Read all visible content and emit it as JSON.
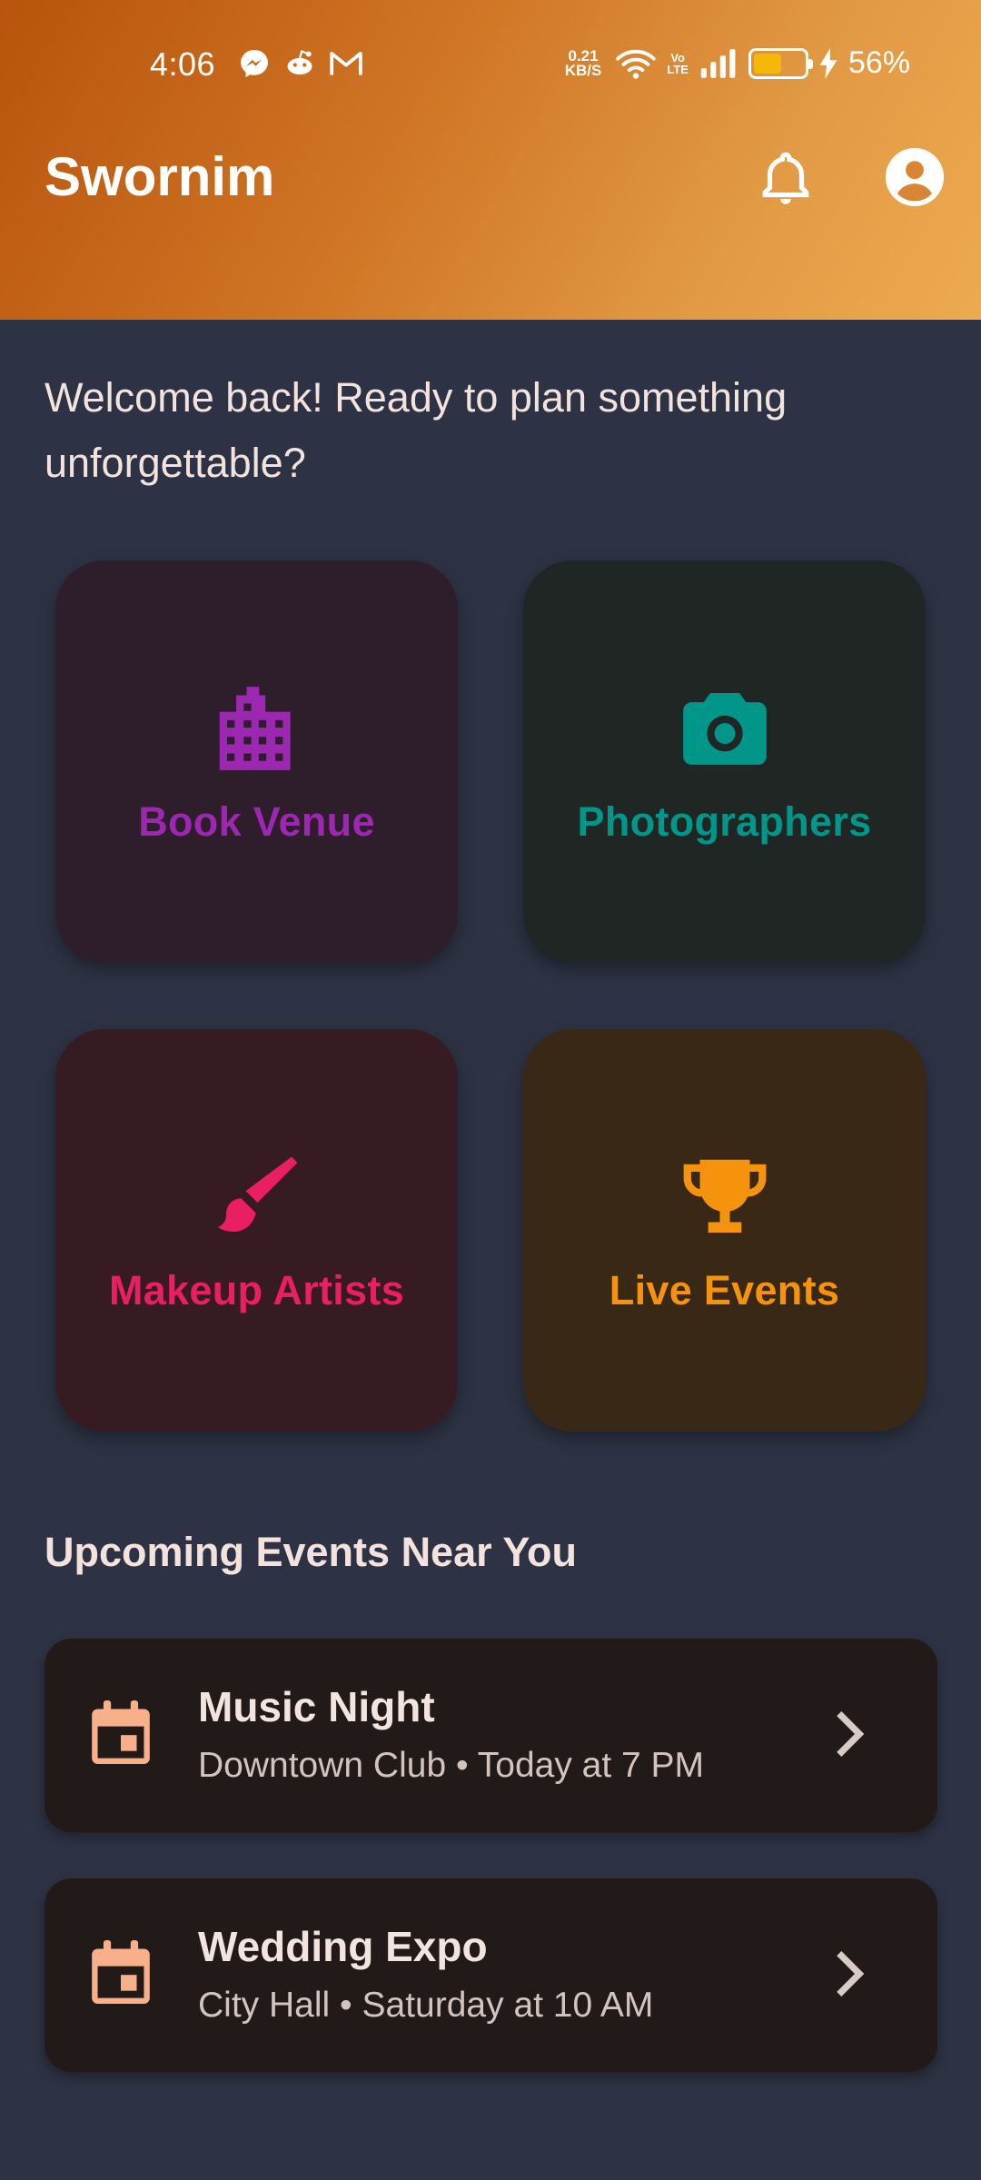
{
  "status_bar": {
    "time": "4:06",
    "net_speed_value": "0.21",
    "net_speed_unit": "KB/S",
    "volte_top": "Vo",
    "volte_bottom": "LTE",
    "battery_percent": "56%",
    "battery_level": 0.56,
    "notification_icons": [
      "messenger-icon",
      "reddit-icon",
      "gmail-icon"
    ]
  },
  "header": {
    "title": "Swornim",
    "gradient_start": "#b8540d",
    "gradient_end": "#eeaa50"
  },
  "welcome_text": "Welcome back! Ready to plan something unforgettable?",
  "tiles": [
    {
      "label": "Book Venue",
      "icon": "building-icon",
      "color": "#9c27b0",
      "background": "#2e1d2a"
    },
    {
      "label": "Photographers",
      "icon": "camera-icon",
      "color": "#00968a",
      "background": "#1f2623"
    },
    {
      "label": "Makeup Artists",
      "icon": "brush-icon",
      "color": "#e91e63",
      "background": "#361b22"
    },
    {
      "label": "Live Events",
      "icon": "trophy-icon",
      "color": "#f5930c",
      "background": "#3a2817"
    }
  ],
  "upcoming": {
    "title": "Upcoming Events Near You",
    "events": [
      {
        "name": "Music Night",
        "details": "Downtown Club • Today at 7 PM",
        "icon": "calendar-icon"
      },
      {
        "name": "Wedding Expo",
        "details": "City Hall • Saturday at 10 AM",
        "icon": "calendar-icon"
      }
    ]
  },
  "colors": {
    "background": "#2d3344",
    "card": "#211a18",
    "calendar_accent": "#f7b08a",
    "text_primary": "#f4e3dc"
  }
}
